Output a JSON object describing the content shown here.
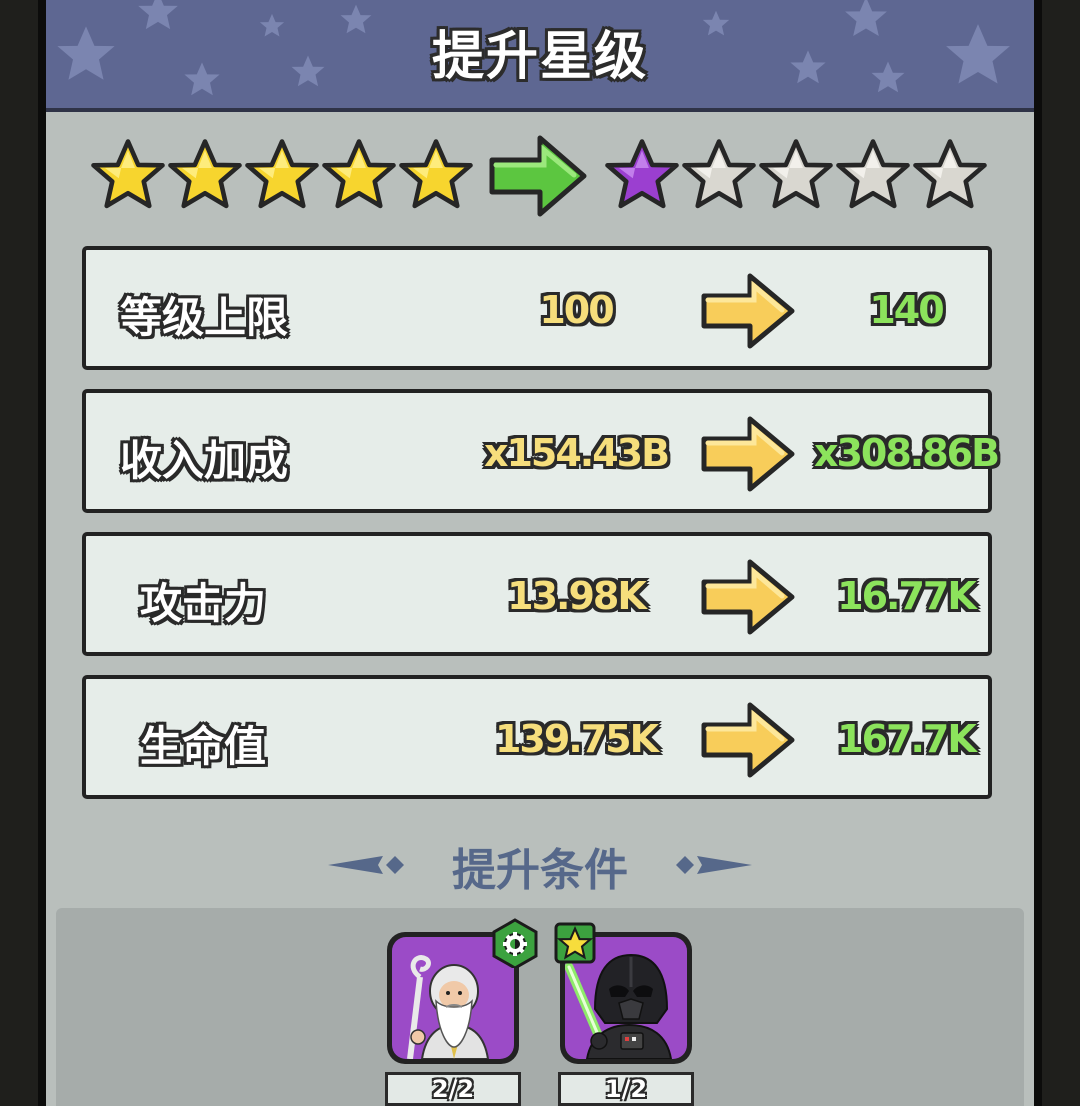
{
  "title": "提升星级",
  "stars": {
    "current": [
      "gold",
      "gold",
      "gold",
      "gold",
      "gold"
    ],
    "next": [
      "purple",
      "gray",
      "gray",
      "gray",
      "gray"
    ],
    "arrow_icon": "green-arrow-right-icon"
  },
  "stats": [
    {
      "label": "等级上限",
      "current": "100",
      "next": "140"
    },
    {
      "label": "收入加成",
      "current": "x154.43B",
      "next": "x308.86B"
    },
    {
      "label": "攻击力",
      "current": "13.98K",
      "next": "16.77K"
    },
    {
      "label": "生命值",
      "current": "139.75K",
      "next": "167.7K"
    }
  ],
  "requirements": {
    "title": "提升条件",
    "items": [
      {
        "character": "wizard",
        "badge_icon": "gear-badge-icon",
        "count": "2/2"
      },
      {
        "character": "dark-knight",
        "badge_icon": "star-badge-icon",
        "count": "1/2"
      }
    ]
  },
  "colors": {
    "header_bg": "#5e6792",
    "panel_bg": "#b9bfbc",
    "current_value": "#f6de7c",
    "next_value": "#8ce35c",
    "section_title": "#56688a",
    "card_purple": "#9b4bc7"
  }
}
